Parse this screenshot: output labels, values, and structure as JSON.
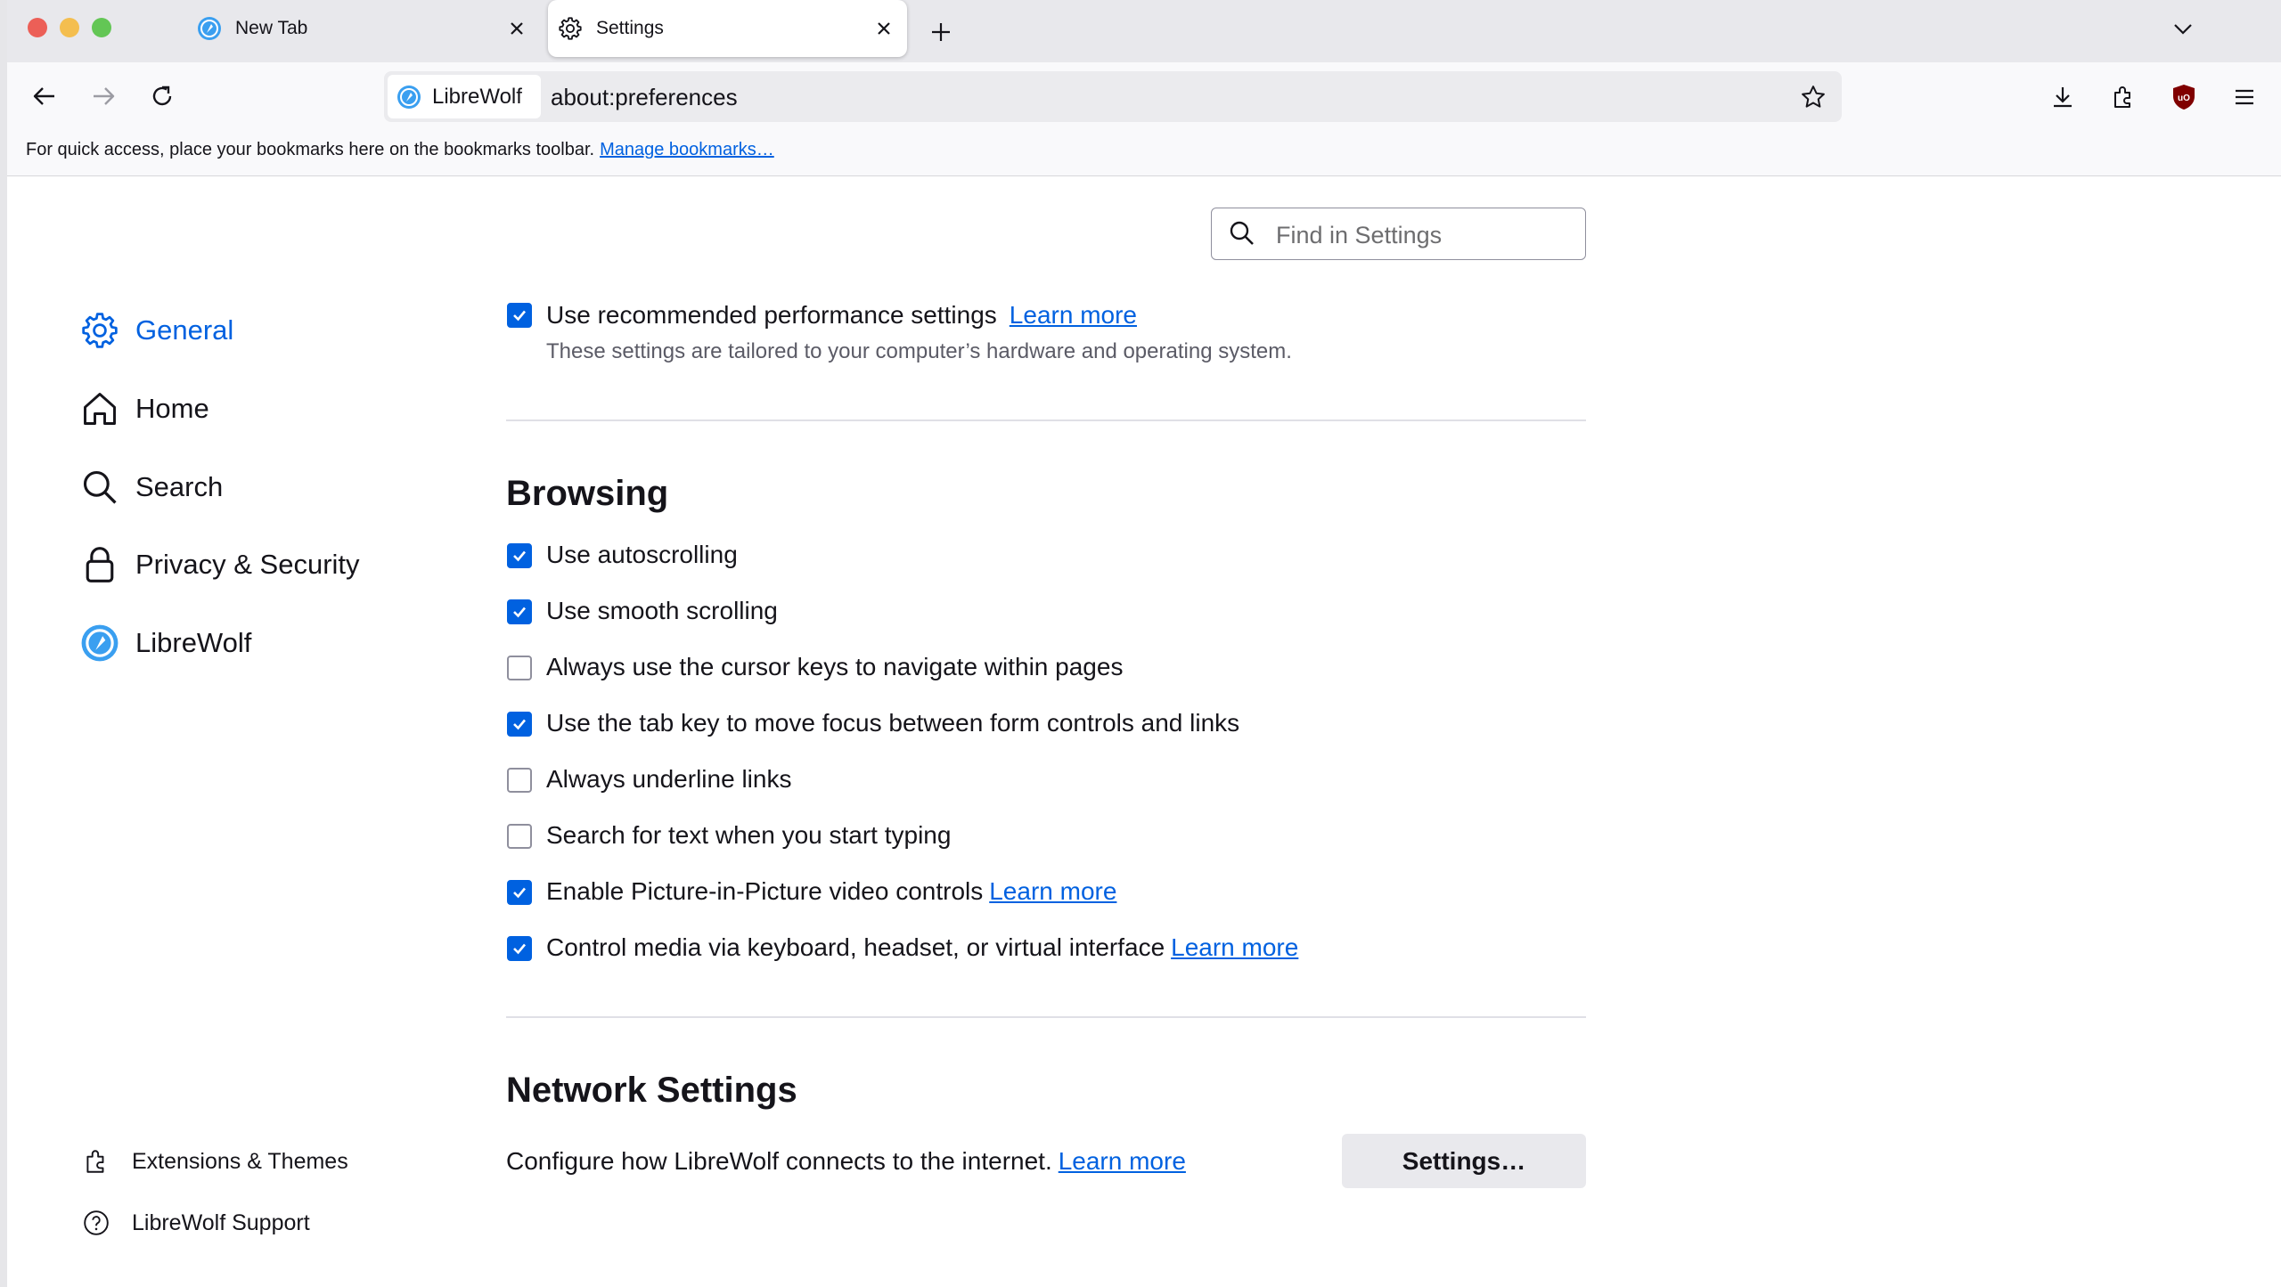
{
  "browser": {
    "tabs": [
      {
        "title": "New Tab"
      },
      {
        "title": "Settings"
      }
    ],
    "identity_label": "LibreWolf",
    "url": "about:preferences"
  },
  "bookmarks_bar": {
    "text": "For quick access, place your bookmarks here on the bookmarks toolbar.",
    "link": "Manage bookmarks…"
  },
  "search": {
    "placeholder": "Find in Settings"
  },
  "sidebar": {
    "categories": [
      {
        "label": "General",
        "icon": "gear-icon",
        "selected": true
      },
      {
        "label": "Home",
        "icon": "home-icon"
      },
      {
        "label": "Search",
        "icon": "search-icon"
      },
      {
        "label": "Privacy & Security",
        "icon": "lock-icon"
      },
      {
        "label": "LibreWolf",
        "icon": "librewolf-icon"
      }
    ],
    "footer": [
      {
        "label": "Extensions & Themes",
        "icon": "puzzle-icon"
      },
      {
        "label": "LibreWolf Support",
        "icon": "help-icon"
      }
    ]
  },
  "performance": {
    "option": {
      "label": "Use recommended performance settings",
      "checked": true,
      "learn_more": "Learn more"
    },
    "description": "These settings are tailored to your computer’s hardware and operating system."
  },
  "browsing": {
    "heading": "Browsing",
    "options": [
      {
        "label": "Use autoscrolling",
        "checked": true
      },
      {
        "label": "Use smooth scrolling",
        "checked": true
      },
      {
        "label": "Always use the cursor keys to navigate within pages",
        "checked": false
      },
      {
        "label": "Use the tab key to move focus between form controls and links",
        "checked": true
      },
      {
        "label": "Always underline links",
        "checked": false
      },
      {
        "label": "Search for text when you start typing",
        "checked": false
      },
      {
        "label": "Enable Picture-in-Picture video controls",
        "checked": true,
        "learn_more": "Learn more"
      },
      {
        "label": "Control media via keyboard, headset, or virtual interface",
        "checked": true,
        "learn_more": "Learn more"
      }
    ]
  },
  "network": {
    "heading": "Network Settings",
    "description": "Configure how LibreWolf connects to the internet.",
    "learn_more": "Learn more",
    "button": "Settings…"
  },
  "colors": {
    "accent": "#0061e0",
    "tabstrip": "#e8e8ec",
    "toolbar": "#f9f9fb"
  }
}
